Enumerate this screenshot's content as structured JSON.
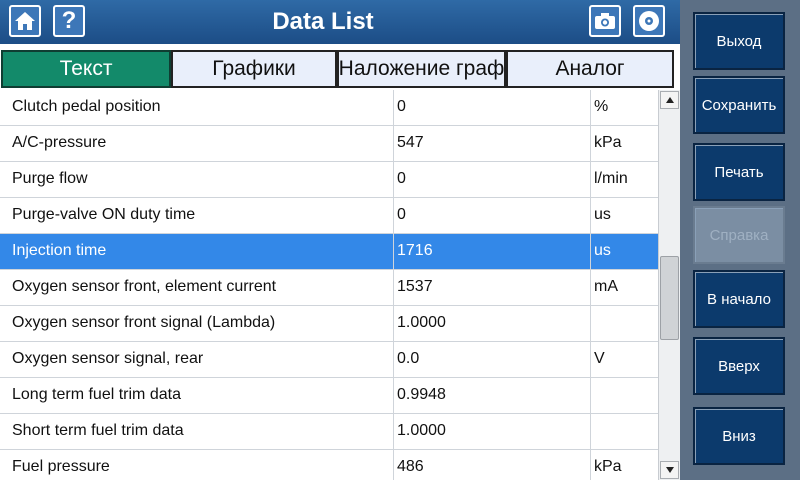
{
  "header": {
    "title": "Data List"
  },
  "tabs": [
    {
      "label": "Текст",
      "active": true
    },
    {
      "label": "Графики",
      "active": false
    },
    {
      "label": "Наложение граф",
      "active": false
    },
    {
      "label": "Аналог",
      "active": false
    }
  ],
  "rows": [
    {
      "name": "Clutch pedal position",
      "value": "0",
      "unit": "%"
    },
    {
      "name": "A/C-pressure",
      "value": "547",
      "unit": "kPa"
    },
    {
      "name": "Purge flow",
      "value": "0",
      "unit": "l/min"
    },
    {
      "name": "Purge-valve ON duty time",
      "value": "0",
      "unit": "us"
    },
    {
      "name": "Injection time",
      "value": "1716",
      "unit": "us",
      "selected": true
    },
    {
      "name": "Oxygen sensor front, element current",
      "value": "1537",
      "unit": "mA"
    },
    {
      "name": "Oxygen sensor front signal (Lambda)",
      "value": "1.0000",
      "unit": ""
    },
    {
      "name": "Oxygen sensor signal, rear",
      "value": "0.0",
      "unit": "V"
    },
    {
      "name": "Long term fuel trim data",
      "value": "0.9948",
      "unit": ""
    },
    {
      "name": "Short term fuel trim data",
      "value": "1.0000",
      "unit": ""
    },
    {
      "name": "Fuel pressure",
      "value": "486",
      "unit": "kPa"
    }
  ],
  "sidebar": {
    "exit": "Выход",
    "save": "Сохранить",
    "print": "Печать",
    "help": "Справка",
    "start": "В начало",
    "up": "Вверх",
    "down": "Вниз"
  },
  "colors": {
    "header": "#1c4d86",
    "active_tab": "#138a6a",
    "selected_row": "#3388e8",
    "sidebar_button": "#0c3a6c"
  }
}
